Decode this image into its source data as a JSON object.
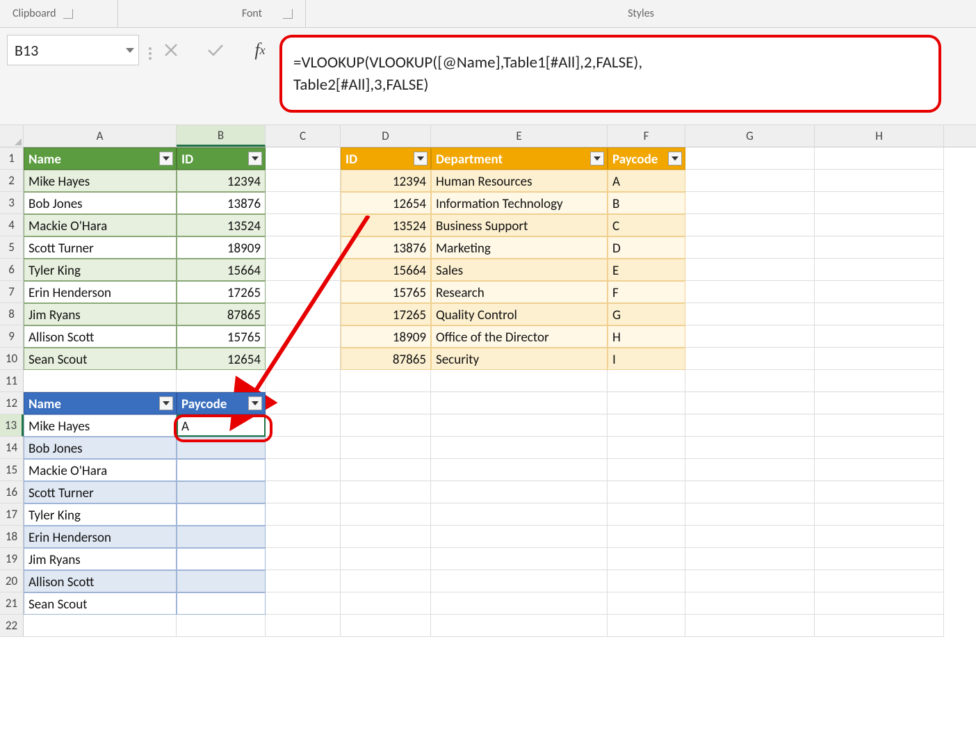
{
  "ribbon": {
    "clipboard": "Clipboard",
    "font": "Font",
    "styles": "Styles"
  },
  "nameBox": "B13",
  "formula": {
    "line1": "=VLOOKUP(VLOOKUP([@Name],Table1[#All],2,FALSE),",
    "line2": "Table2[#All],3,FALSE)"
  },
  "columns": [
    "A",
    "B",
    "C",
    "D",
    "E",
    "F",
    "G",
    "H"
  ],
  "rowNumbers": [
    1,
    2,
    3,
    4,
    5,
    6,
    7,
    8,
    9,
    10,
    11,
    12,
    13,
    14,
    15,
    16,
    17,
    18,
    19,
    20,
    21,
    22
  ],
  "table1": {
    "headers": [
      "Name",
      "ID"
    ],
    "rows": [
      {
        "name": "Mike Hayes",
        "id": "12394"
      },
      {
        "name": "Bob Jones",
        "id": "13876"
      },
      {
        "name": "Mackie O'Hara",
        "id": "13524"
      },
      {
        "name": "Scott Turner",
        "id": "18909"
      },
      {
        "name": "Tyler King",
        "id": "15664"
      },
      {
        "name": "Erin Henderson",
        "id": "17265"
      },
      {
        "name": "Jim Ryans",
        "id": "87865"
      },
      {
        "name": "Allison Scott",
        "id": "15765"
      },
      {
        "name": "Sean Scout",
        "id": "12654"
      }
    ]
  },
  "table2": {
    "headers": [
      "ID",
      "Department",
      "Paycode"
    ],
    "rows": [
      {
        "id": "12394",
        "dept": "Human Resources",
        "pc": "A"
      },
      {
        "id": "12654",
        "dept": "Information Technology",
        "pc": "B"
      },
      {
        "id": "13524",
        "dept": "Business Support",
        "pc": "C"
      },
      {
        "id": "13876",
        "dept": "Marketing",
        "pc": "D"
      },
      {
        "id": "15664",
        "dept": "Sales",
        "pc": "E"
      },
      {
        "id": "15765",
        "dept": "Research",
        "pc": "F"
      },
      {
        "id": "17265",
        "dept": "Quality Control",
        "pc": "G"
      },
      {
        "id": "18909",
        "dept": "Office of the Director",
        "pc": "H"
      },
      {
        "id": "87865",
        "dept": "Security",
        "pc": "I"
      }
    ]
  },
  "table3": {
    "headers": [
      "Name",
      "Paycode"
    ],
    "rows": [
      {
        "name": "Mike Hayes",
        "pc": "A"
      },
      {
        "name": "Bob Jones",
        "pc": ""
      },
      {
        "name": "Mackie O'Hara",
        "pc": ""
      },
      {
        "name": "Scott Turner",
        "pc": ""
      },
      {
        "name": "Tyler King",
        "pc": ""
      },
      {
        "name": "Erin Henderson",
        "pc": ""
      },
      {
        "name": "Jim Ryans",
        "pc": ""
      },
      {
        "name": "Allison Scott",
        "pc": ""
      },
      {
        "name": "Sean Scout",
        "pc": ""
      }
    ]
  }
}
